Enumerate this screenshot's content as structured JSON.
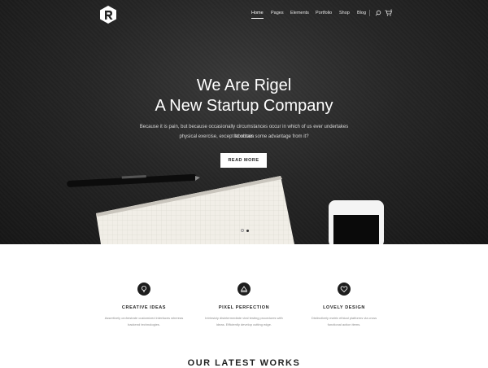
{
  "nav": {
    "items": [
      {
        "label": "Home",
        "active": true
      },
      {
        "label": "Pages"
      },
      {
        "label": "Elements"
      },
      {
        "label": "Portfolio"
      },
      {
        "label": "Shop"
      },
      {
        "label": "Blog"
      }
    ],
    "cart_count": "0",
    "search_icon": "search-icon",
    "cart_icon": "cart-icon"
  },
  "hero": {
    "title_line1": "We Are Rigel",
    "title_line2": "A New Startup Company",
    "text_line1": "Because it is pain, but because occasionally circumstances occur in which of us ever undertakes laborious",
    "text_line2": "physical exercise, except to obtain some advantage from it?",
    "button": "READ MORE"
  },
  "features": [
    {
      "icon": "lightbulb-icon",
      "title": "CREATIVE IDEAS",
      "text_line1": "Assertively orchestrate customized interfaces whereas",
      "text_line2": "backend technologies."
    },
    {
      "icon": "monitor-icon",
      "title": "PIXEL PERFECTION",
      "text_line1": "Intrinsicly disintermediate viral testing procedures with",
      "text_line2": "ideas. Efficiently develop cutting edge."
    },
    {
      "icon": "heart-icon",
      "title": "LOVELY DESIGN",
      "text_line1": "Distinctively matrix ethical platforms via cross",
      "text_line2": "functional action items."
    }
  ],
  "works_title": "OUR LATEST WORKS",
  "colors": {
    "hero_bg": "#262626",
    "text_dark": "#222222",
    "muted": "#8a8a8a"
  }
}
